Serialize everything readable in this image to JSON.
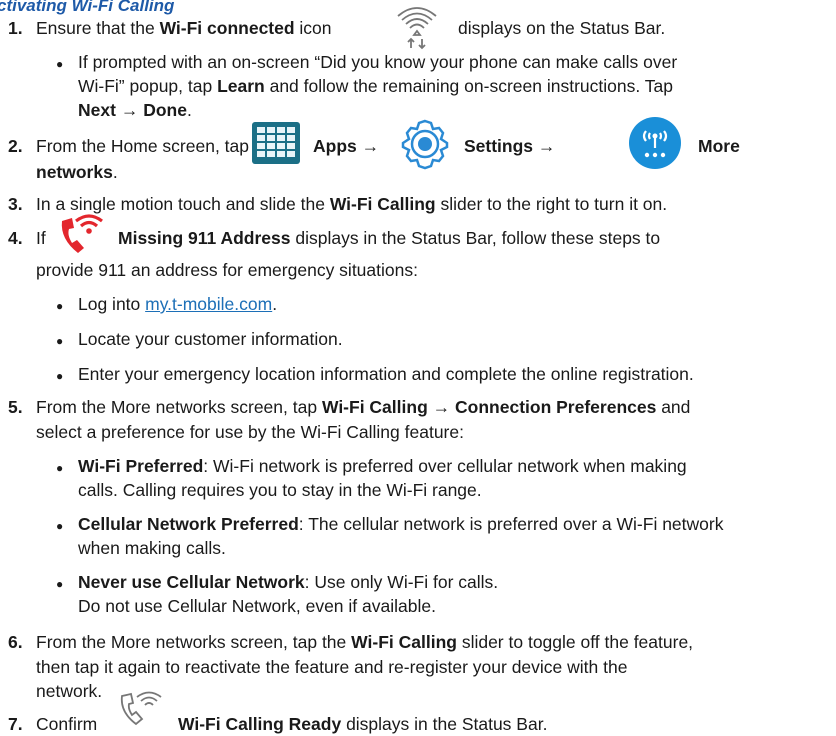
{
  "heading": "ctivating Wi-Fi Calling",
  "bullet_char": "●",
  "arrow": "→",
  "step1": {
    "num": "1.",
    "t1": "Ensure that the ",
    "b1": "Wi-Fi connected",
    "t2": " icon",
    "t3": "displays on the Status Bar.",
    "icon": "wifi-connected-icon",
    "sub": {
      "l1": "If prompted with an on-screen “Did you know your phone can make calls over",
      "l2a": "Wi-Fi” popup, tap ",
      "l2b": "Learn",
      "l2c": " and follow the remaining on-screen instructions. Tap",
      "l3a": "Next",
      "l3c": "Done",
      "l3d": "."
    }
  },
  "step2": {
    "num": "2.",
    "t1": "From the Home screen, tap",
    "apps": "Apps",
    "settings": "Settings",
    "more": "More",
    "networks": "networks",
    "period": ".",
    "icons": [
      "apps-grid-icon",
      "settings-gear-icon",
      "more-networks-icon"
    ]
  },
  "step3": {
    "num": "3.",
    "t1": "In a single motion touch and slide the ",
    "b1": "Wi-Fi Calling",
    "t2": " slider to the right to turn it on."
  },
  "step4": {
    "num": "4.",
    "t1": "If",
    "b1": "Missing 911 Address",
    "t2": " displays in the Status Bar, follow these steps to",
    "l2": "provide 911 an address for emergency situations:",
    "icon": "missing-911-address-icon",
    "bullets": {
      "b1a": "Log into ",
      "b1link": "my.t-mobile.com",
      "b1c": ".",
      "b2": "Locate your customer information.",
      "b3": "Enter your emergency location information and complete the online registration."
    }
  },
  "step5": {
    "num": "5.",
    "t1": "From the More networks screen, tap ",
    "b1": "Wi-Fi Calling",
    "b2": "Connection Preferences",
    "t2": " and",
    "l2": "select a preference for use by the Wi-Fi Calling feature:",
    "opts": {
      "o1b": "Wi-Fi Preferred",
      "o1t": ": Wi-Fi network is preferred over cellular network when making",
      "o1l2": "calls. Calling requires you to stay in the Wi-Fi range.",
      "o2b": "Cellular Network Preferred",
      "o2t": ": The cellular network is preferred over a Wi-Fi network",
      "o2l2": "when making calls.",
      "o3b": "Never use Cellular Network",
      "o3t": ": Use only Wi-Fi for calls.",
      "o3l2": "Do not use Cellular Network, even if available."
    }
  },
  "step6": {
    "num": "6.",
    "t1": "From the More networks screen, tap the ",
    "b1": "Wi-Fi Calling",
    "t2": " slider to toggle off the feature,",
    "l2": "then tap it again to reactivate the feature and re-register your device with the",
    "l3": "network."
  },
  "step7": {
    "num": "7.",
    "t1": "Confirm",
    "b1": "Wi-Fi Calling Ready",
    "t2": " displays in the Status Bar.",
    "icon": "wifi-calling-ready-icon"
  },
  "colors": {
    "heading": "#1e5aa8",
    "link": "#1c6fb7",
    "missing_911_red": "#e3262d",
    "more_networks_blue": "#1a8fd8",
    "settings_blue": "#2a8ad4",
    "apps_teal": "#1b6f86"
  }
}
